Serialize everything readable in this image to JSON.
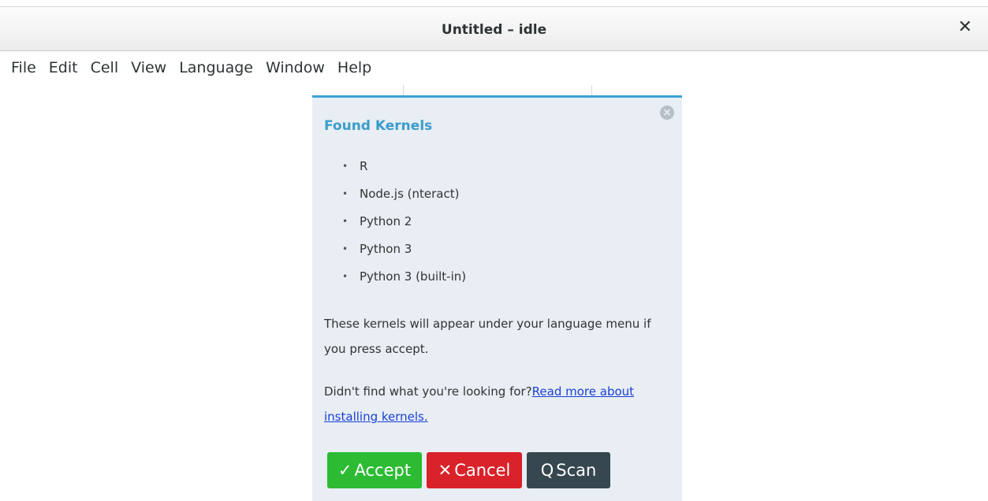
{
  "window": {
    "title": "Untitled – idle",
    "close_glyph": "✕"
  },
  "menubar": {
    "items": [
      "File",
      "Edit",
      "Cell",
      "View",
      "Language",
      "Window",
      "Help"
    ]
  },
  "dialog": {
    "title": "Found Kernels",
    "close_glyph": "×",
    "kernels": [
      "R",
      "Node.js (nteract)",
      "Python 2",
      "Python 3",
      "Python 3 (built-in)"
    ],
    "bullet": "•",
    "info_text": "These kernels will appear under your language menu if you press accept.",
    "help_text": "Didn't find what you're looking for?",
    "help_link": "Read more about installing kernels.",
    "accent_color": "#3aa3d6",
    "buttons": {
      "accept": {
        "label": "Accept",
        "icon": "check-icon",
        "glyph": "✓",
        "color": "#2cbb32"
      },
      "cancel": {
        "label": "Cancel",
        "icon": "x-icon",
        "glyph": "✕",
        "color": "#d9222a"
      },
      "scan": {
        "label": "Scan",
        "icon": "search-icon",
        "glyph": "Q",
        "color": "#37474f"
      }
    }
  }
}
